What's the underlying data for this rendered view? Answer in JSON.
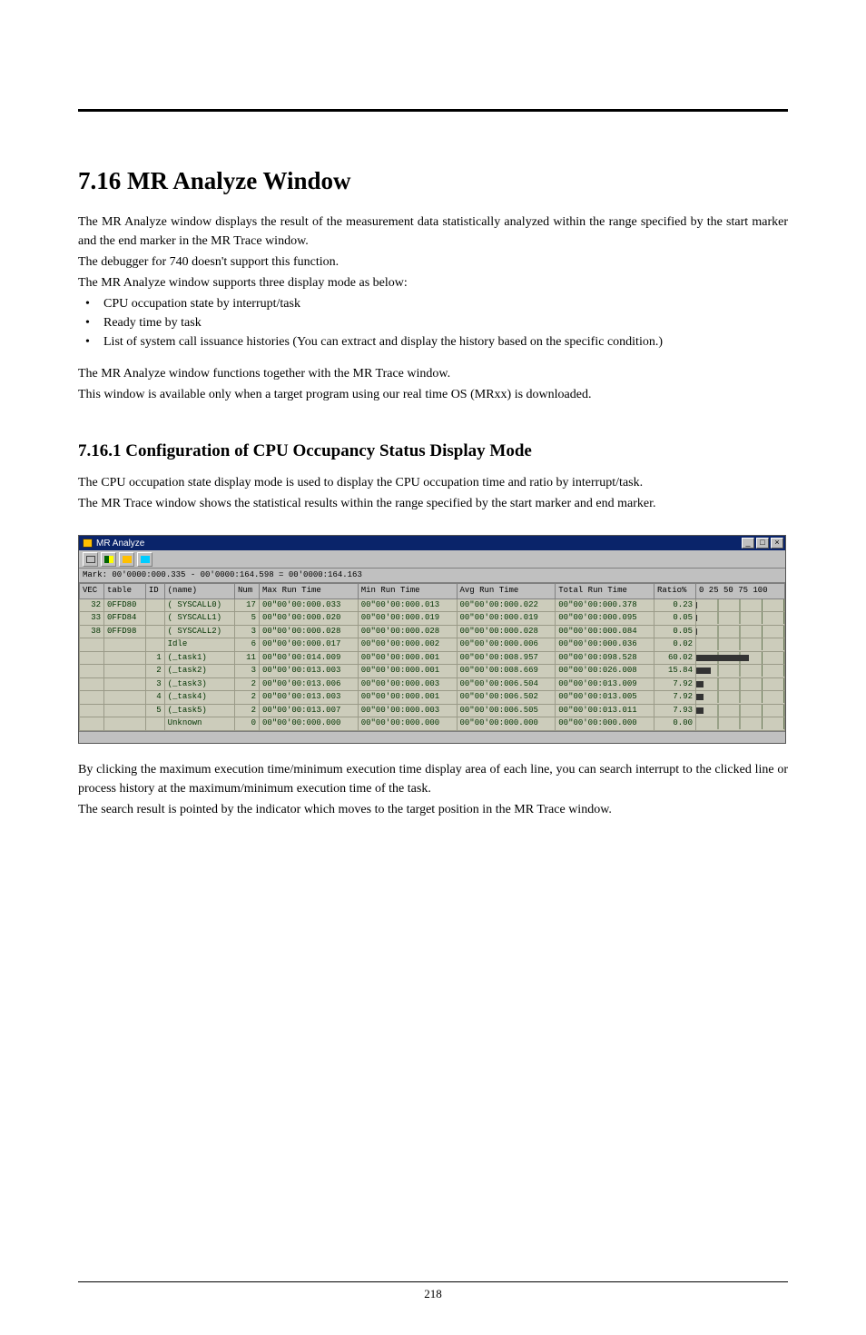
{
  "heading_main": "7.16 MR Analyze Window",
  "intro_p1": "The MR Analyze window displays the result of the measurement data statistically analyzed within the range specified by the start marker and the end marker in the MR Trace window.",
  "intro_p2": "The debugger for 740 doesn't support this function.",
  "intro_p3": "The MR Analyze window supports three display mode as below:",
  "bullets": [
    "CPU occupation state by interrupt/task",
    "Ready time by task",
    "List of system call issuance histories (You can extract and display the history based on the specific condition.)"
  ],
  "intro_p4": "The MR Analyze window functions together with the MR Trace window.",
  "intro_p5": "This window is available only when a target program using our real time OS (MRxx) is downloaded.",
  "heading_sub": "7.16.1 Configuration of CPU Occupancy Status Display Mode",
  "sub_p1": "The CPU occupation state display mode is used to display the CPU occupation time and ratio by interrupt/task.",
  "sub_p2": "The MR Trace window shows the statistical results within the range specified by the start marker and end marker.",
  "after_p1": "By clicking the maximum execution time/minimum execution time display area of each line, you can search interrupt to the clicked line or process history at the maximum/minimum execution time of the task.",
  "after_p2": "The search result is pointed by the indicator which moves to the target position in the MR Trace window.",
  "page_number": "218",
  "window": {
    "title": "MR Analyze",
    "status": "Mark: 00'0000:000.335 - 00'0000:164.598 = 00'0000:164.163",
    "headers": [
      "VEC",
      "table",
      "ID",
      "(name)",
      "Num",
      "Max Run Time",
      "Min Run Time",
      "Avg Run Time",
      "Total Run Time",
      "Ratio%",
      "0   25   50   75 100"
    ],
    "rows": [
      {
        "vec": "32",
        "table": "0FFD80",
        "id": "",
        "name": "( SYSCALL0)",
        "num": "17",
        "max": "00\"00'00:000.033",
        "min": "00\"00'00:000.013",
        "avg": "00\"00'00:000.022",
        "total": "00\"00'00:000.378",
        "ratio": "0.23",
        "bar": 0.3
      },
      {
        "vec": "33",
        "table": "0FFD84",
        "id": "",
        "name": "( SYSCALL1)",
        "num": "5",
        "max": "00\"00'00:000.020",
        "min": "00\"00'00:000.019",
        "avg": "00\"00'00:000.019",
        "total": "00\"00'00:000.095",
        "ratio": "0.05",
        "bar": 0.1
      },
      {
        "vec": "38",
        "table": "0FFD98",
        "id": "",
        "name": "( SYSCALL2)",
        "num": "3",
        "max": "00\"00'00:000.028",
        "min": "00\"00'00:000.028",
        "avg": "00\"00'00:000.028",
        "total": "00\"00'00:000.084",
        "ratio": "0.05",
        "bar": 0.1
      },
      {
        "vec": "",
        "table": "",
        "id": "",
        "name": "Idle",
        "num": "6",
        "max": "00\"00'00:000.017",
        "min": "00\"00'00:000.002",
        "avg": "00\"00'00:000.006",
        "total": "00\"00'00:000.036",
        "ratio": "0.02",
        "bar": 0.05
      },
      {
        "vec": "",
        "table": "",
        "id": "1",
        "name": "(_task1)",
        "num": "11",
        "max": "00\"00'00:014.009",
        "min": "00\"00'00:000.001",
        "avg": "00\"00'00:008.957",
        "total": "00\"00'00:098.528",
        "ratio": "60.02",
        "bar": 60
      },
      {
        "vec": "",
        "table": "",
        "id": "2",
        "name": "(_task2)",
        "num": "3",
        "max": "00\"00'00:013.003",
        "min": "00\"00'00:000.001",
        "avg": "00\"00'00:008.669",
        "total": "00\"00'00:026.008",
        "ratio": "15.84",
        "bar": 16
      },
      {
        "vec": "",
        "table": "",
        "id": "3",
        "name": "(_task3)",
        "num": "2",
        "max": "00\"00'00:013.006",
        "min": "00\"00'00:000.003",
        "avg": "00\"00'00:006.504",
        "total": "00\"00'00:013.009",
        "ratio": "7.92",
        "bar": 8
      },
      {
        "vec": "",
        "table": "",
        "id": "4",
        "name": "(_task4)",
        "num": "2",
        "max": "00\"00'00:013.003",
        "min": "00\"00'00:000.001",
        "avg": "00\"00'00:006.502",
        "total": "00\"00'00:013.005",
        "ratio": "7.92",
        "bar": 8
      },
      {
        "vec": "",
        "table": "",
        "id": "5",
        "name": "(_task5)",
        "num": "2",
        "max": "00\"00'00:013.007",
        "min": "00\"00'00:000.003",
        "avg": "00\"00'00:006.505",
        "total": "00\"00'00:013.011",
        "ratio": "7.93",
        "bar": 8
      },
      {
        "vec": "",
        "table": "",
        "id": "",
        "name": "Unknown",
        "num": "0",
        "max": "00\"00'00:000.000",
        "min": "00\"00'00:000.000",
        "avg": "00\"00'00:000.000",
        "total": "00\"00'00:000.000",
        "ratio": "0.00",
        "bar": 0
      }
    ]
  }
}
